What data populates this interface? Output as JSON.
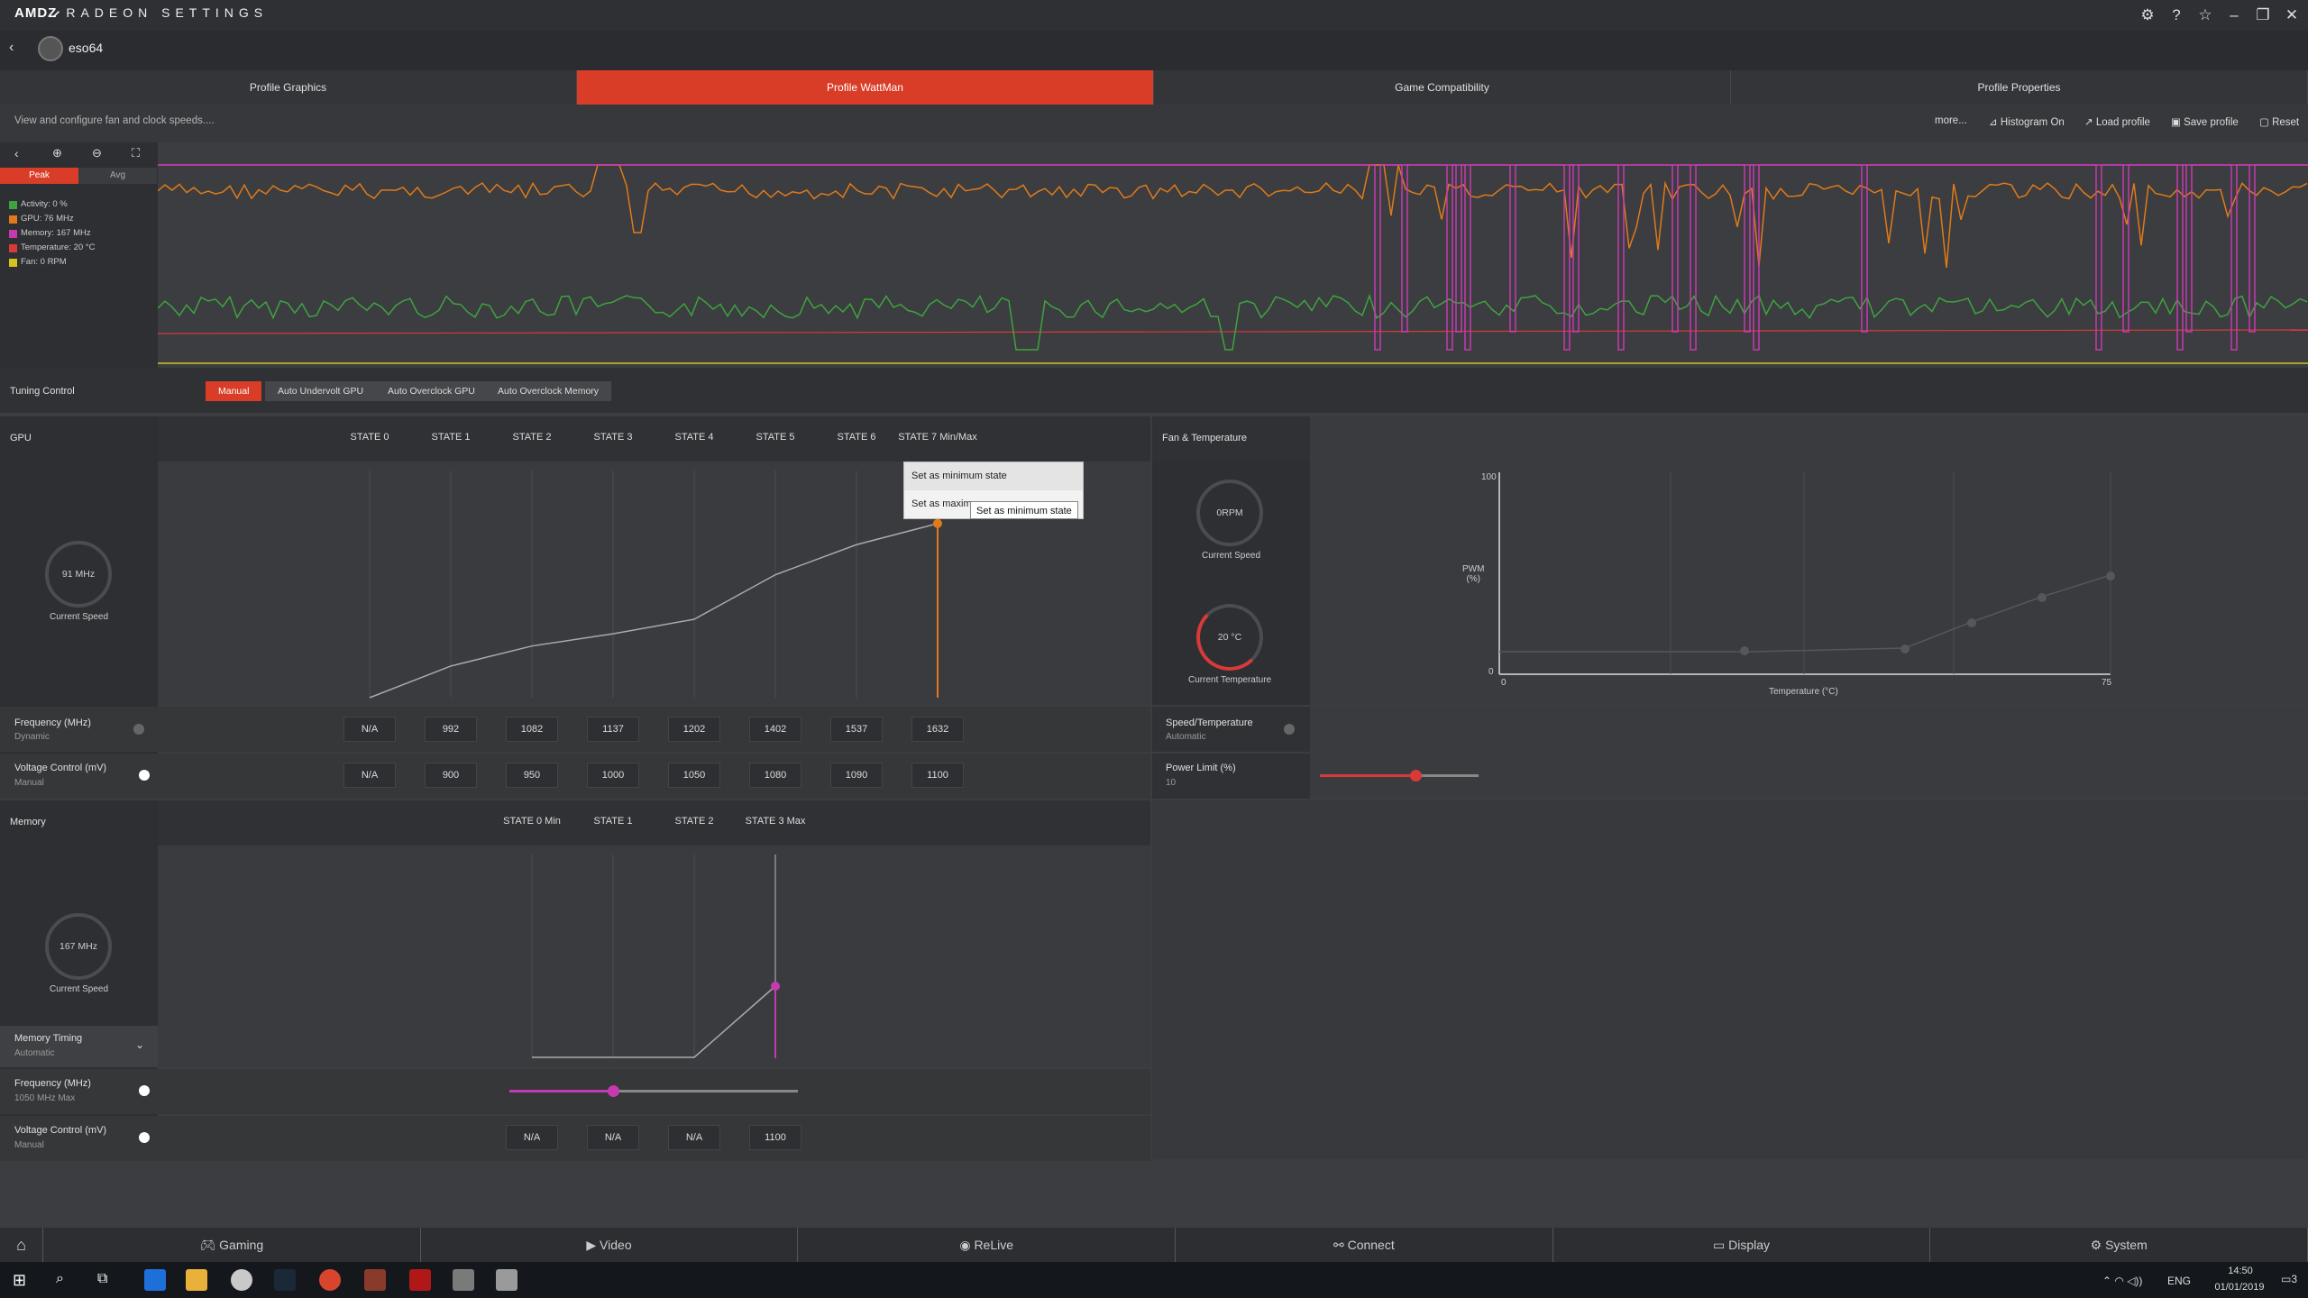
{
  "app": {
    "brand": "AMDZ̷",
    "title": "RADEON SETTINGS",
    "profile_name": "eso64"
  },
  "tabs": [
    "Profile Graphics",
    "Profile WattMan",
    "Game Compatibility",
    "Profile Properties"
  ],
  "subheader": {
    "text": "View and configure fan and clock speeds....",
    "more": "more...",
    "histogram": "Histogram On",
    "load": "Load profile",
    "save": "Save profile",
    "reset": "Reset"
  },
  "monitor": {
    "peak": "Peak",
    "avg": "Avg",
    "legend": [
      {
        "label": "Activity: 0 %",
        "color": "#3fa33f"
      },
      {
        "label": "GPU: 76 MHz",
        "color": "#e07a1a"
      },
      {
        "label": "Memory: 167 MHz",
        "color": "#c63ab0"
      },
      {
        "label": "Temperature: 20 °C",
        "color": "#d83a3a"
      },
      {
        "label": "Fan: 0 RPM",
        "color": "#d6c11e"
      }
    ]
  },
  "tuning": {
    "label": "Tuning Control",
    "buttons": [
      "Manual",
      "Auto Undervolt GPU",
      "Auto Overclock GPU",
      "Auto Overclock Memory"
    ]
  },
  "gpu": {
    "label": "GPU",
    "states": [
      "STATE 0",
      "STATE 1",
      "STATE 2",
      "STATE 3",
      "STATE 4",
      "STATE 5",
      "STATE 6",
      "STATE 7 Min/Max"
    ],
    "gauge": "91 MHz",
    "gauge_label": "Current Speed",
    "freq_label": "Frequency (MHz)",
    "freq_sub": "Dynamic",
    "freq": [
      "N/A",
      "992",
      "1082",
      "1137",
      "1202",
      "1402",
      "1537",
      "1632"
    ],
    "volt_label": "Voltage Control (mV)",
    "volt_sub": "Manual",
    "volt": [
      "N/A",
      "900",
      "950",
      "1000",
      "1050",
      "1080",
      "1090",
      "1100"
    ],
    "menu": {
      "item1": "Set as minimum state",
      "item2": "Set as maxim",
      "tooltip": "Set as minimum state"
    }
  },
  "fan": {
    "label": "Fan & Temperature",
    "rpm": "0RPM",
    "speed_label": "Current Speed",
    "temp": "20 °C",
    "temp_label": "Current Temperature",
    "pwm_label": "PWM\n(%)",
    "y_top": "100",
    "y_bottom": "0",
    "x_left": "0",
    "x_right": "75",
    "x_label": "Temperature (°C)",
    "speedtemp_label": "Speed/Temperature",
    "speedtemp_sub": "Automatic",
    "power_label": "Power Limit (%)",
    "power_val": "10",
    "power_fraction": 0.6
  },
  "memory": {
    "label": "Memory",
    "states": [
      "STATE 0 Min",
      "STATE 1",
      "STATE 2",
      "STATE 3 Max"
    ],
    "gauge": "167 MHz",
    "gauge_label": "Current Speed",
    "timing_label": "Memory Timing",
    "timing_sub": "Automatic",
    "freq_label": "Frequency (MHz)",
    "freq_sub": "1050 MHz Max",
    "volt_label": "Voltage Control (mV)",
    "volt_sub": "Manual",
    "volt": [
      "N/A",
      "N/A",
      "N/A",
      "1100"
    ],
    "freq_fraction": 0.36
  },
  "bottom_nav": [
    "Gaming",
    "Video",
    "ReLive",
    "Connect",
    "Display",
    "System"
  ],
  "taskbar": {
    "lang": "ENG",
    "time": "14:50",
    "date": "01/01/2019",
    "notif": "3"
  }
}
